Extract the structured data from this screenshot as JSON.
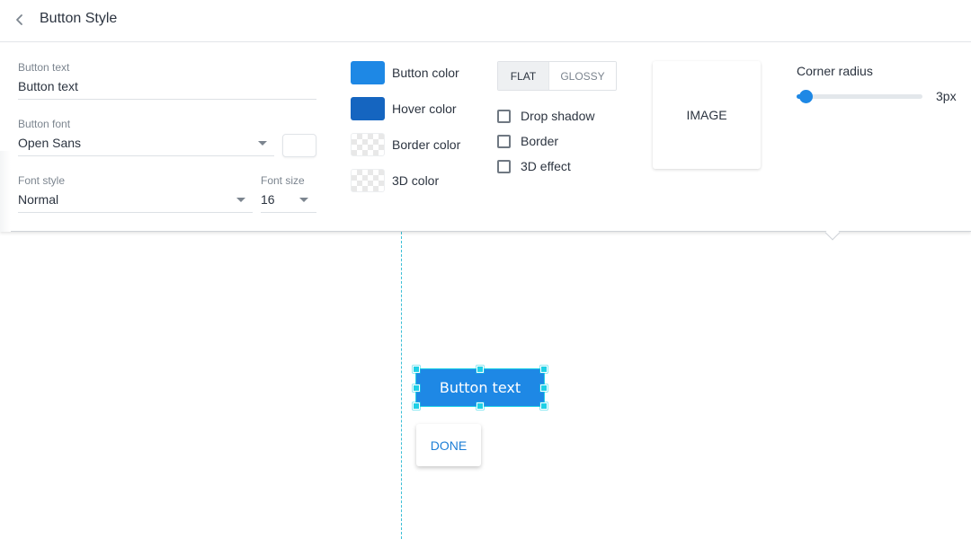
{
  "header": {
    "back_icon": "chevron-left-icon",
    "title": "Button Style"
  },
  "panel": {
    "button_text": {
      "label": "Button text",
      "value": "Button text"
    },
    "button_font": {
      "label": "Button font",
      "value": "Open Sans",
      "font_color": "#ffffff"
    },
    "font_style": {
      "label": "Font style",
      "value": "Normal"
    },
    "font_size": {
      "label": "Font size",
      "value": "16"
    },
    "colors": [
      {
        "label": "Button color",
        "color": "#1e88e5"
      },
      {
        "label": "Hover color",
        "color": "#1565c0"
      },
      {
        "label": "Border color",
        "color": "transparent"
      },
      {
        "label": "3D color",
        "color": "transparent"
      }
    ],
    "style_toggle": {
      "options": [
        "FLAT",
        "GLOSSY"
      ],
      "selected": "FLAT"
    },
    "checkboxes": [
      {
        "label": "Drop shadow",
        "checked": false
      },
      {
        "label": "Border",
        "checked": false
      },
      {
        "label": "3D effect",
        "checked": false
      }
    ],
    "image_button_label": "IMAGE",
    "corner_radius": {
      "label": "Corner radius",
      "value": 3,
      "display": "3px",
      "fraction": 0.07
    }
  },
  "canvas": {
    "button_label": "Button text",
    "button_color": "#1e88e5",
    "done_label": "DONE"
  }
}
